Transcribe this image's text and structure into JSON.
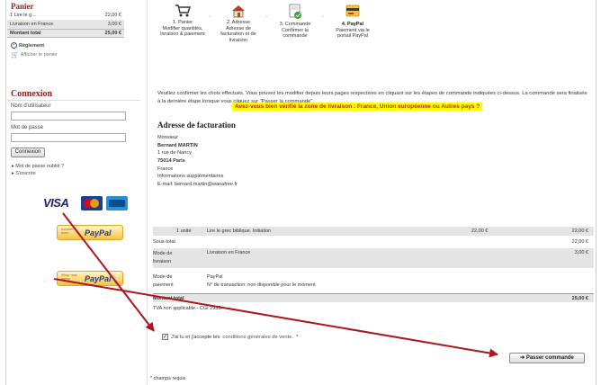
{
  "cart": {
    "title": "Panier",
    "rows": [
      {
        "label": "1  Lire le g...",
        "value": "22,00 €"
      },
      {
        "label": "Livraison en France",
        "value": "3,00 €"
      },
      {
        "label": "Montant total",
        "value": "25,00 €"
      }
    ],
    "reglement": "Règlement",
    "afficher": "Afficher le panier"
  },
  "login": {
    "title": "Connexion",
    "user_label": "Nom d'utilisateur",
    "pass_label": "Mot de passe",
    "button": "Connexion",
    "forgot": "Mot de passe oublié ?",
    "register": "S'inscrire"
  },
  "payment_logos": {
    "visa": "VISA",
    "paypal1_small": "Acheter avec",
    "paypal2_small": "Shop now using",
    "paypal": "PayPal"
  },
  "steps": [
    {
      "num": "1. Panier",
      "lines": [
        "Modifier quantités,",
        "livraison & paiement"
      ]
    },
    {
      "num": "2. Adresse",
      "lines": [
        "Adresse de",
        "facturation et de",
        "livraison"
      ]
    },
    {
      "num": "3. Commande",
      "lines": [
        "Confirmer la",
        "commande"
      ]
    },
    {
      "num": "4. PayPal",
      "lines": [
        "Paiement via le",
        "portail PayPal"
      ]
    }
  ],
  "intro": "Veuillez confirmer les choix effectués. Vous pouvez les modifier depuis leurs pages respectives en cliquant sur les étapes de commande indiquées ci-dessus. La commande sera finalisée à la dernière étape lorsque vous cliquez sur \"Passer la commande\".",
  "warning": "Avez-vous bien vérifié la zone de livraison : France, Union européenne ou Autres pays ?",
  "billing": {
    "title": "Adresse de facturation",
    "lines": [
      "Monsieur",
      "Bernard MARTIN",
      "1 rue de Nancy",
      "75014 Paris",
      "France",
      "Informations supplémentaires",
      "E-mail: bernard.martin@wanafree.fr"
    ]
  },
  "order": {
    "item_qty": "1 unité",
    "item_name": "Lire le grec biblique. Initiation",
    "item_unit": "22,00 €",
    "item_total": "22,00 €",
    "subtotal_label": "Sous-total",
    "subtotal": "22,00 €",
    "shipping_label1": "Mode de",
    "shipping_label2": "livraison",
    "shipping_value": "Livraison en France",
    "shipping_price": "3,00 €",
    "payment_label1": "Mode de",
    "payment_label2": "paiement",
    "payment_value": "PayPal",
    "payment_tx": "N° de transaction: non disponible pour le moment",
    "total_label": "Montant total",
    "total": "25,00 €",
    "tva": "TVA non applicable - CGI 293B"
  },
  "cgv_prefix": "J'ai lu et j'accepte les",
  "cgv_link": "conditions générales de vente.",
  "cgv_star": "*",
  "submit": "Passer commande",
  "required": "* champs requis",
  "colors": {
    "accent": "#8b2020",
    "arrow": "#b0141e",
    "highlight": "#ffff00"
  }
}
